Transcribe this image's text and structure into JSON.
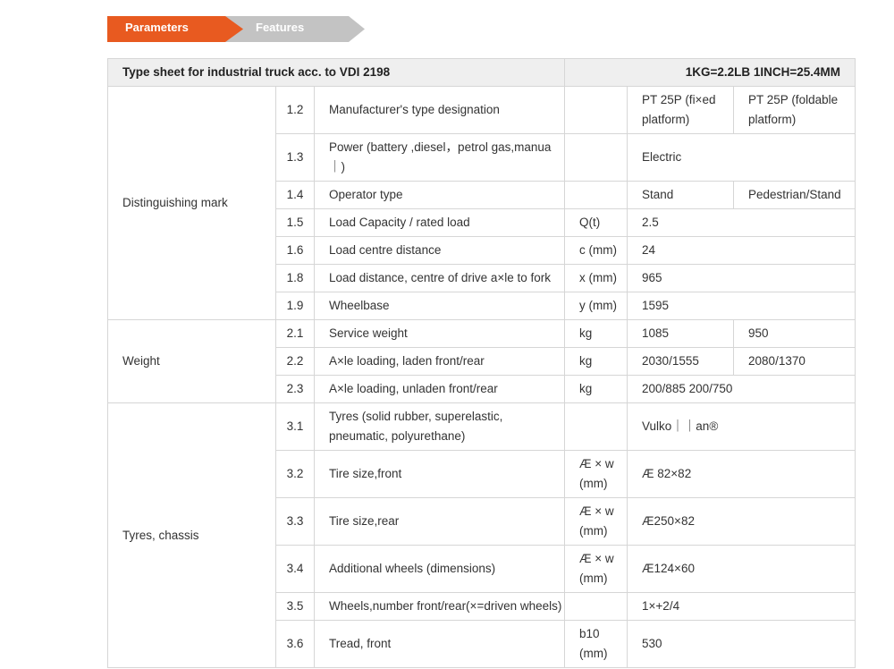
{
  "tabs": {
    "parameters": "Parameters",
    "features": "Features"
  },
  "header": {
    "title": "Type sheet for industrial truck acc. to VDI 2198",
    "units": "1KG=2.2LB 1INCH=25.4MM"
  },
  "groups": {
    "distinguishing": "Distinguishing mark",
    "weight": "Weight",
    "tyres": "Tyres, chassis"
  },
  "rows": [
    {
      "num": "1.2",
      "label": "Manufacturer's type designation",
      "unit": "",
      "v1": "PT 25P (fi×ed platform)",
      "v2": "PT 25P (foldable platform)"
    },
    {
      "num": "1.3",
      "label": "Power (battery ,diesel，petrol gas,manua｜)",
      "unit": "",
      "v1": "Electric",
      "v2": ""
    },
    {
      "num": "1.4",
      "label": "Operator type",
      "unit": "",
      "v1": "Stand",
      "v2": "Pedestrian/Stand"
    },
    {
      "num": "1.5",
      "label": "Load Capacity / rated load",
      "unit": "Q(t)",
      "v1": "2.5",
      "v2": ""
    },
    {
      "num": "1.6",
      "label": "Load centre distance",
      "unit": "c (mm)",
      "v1": "24",
      "v2": ""
    },
    {
      "num": "1.8",
      "label": "Load distance, centre of drive a×le to fork",
      "unit": "x (mm)",
      "v1": "965",
      "v2": ""
    },
    {
      "num": "1.9",
      "label": "Wheelbase",
      "unit": "y (mm)",
      "v1": "1595",
      "v2": ""
    },
    {
      "num": "2.1",
      "label": "Service weight",
      "unit": "kg",
      "v1": "1085",
      "v2": "950"
    },
    {
      "num": "2.2",
      "label": "A×le loading, laden front/rear",
      "unit": "kg",
      "v1": "2030/1555",
      "v2": "2080/1370"
    },
    {
      "num": "2.3",
      "label": "A×le loading, unladen front/rear",
      "unit": "kg",
      "v1": "200/885 200/750",
      "v2": ""
    },
    {
      "num": "3.1",
      "label": "Tyres (solid rubber, superelastic, pneumatic, polyurethane)",
      "unit": "",
      "v1": "Vulko｜｜an®",
      "v2": ""
    },
    {
      "num": "3.2",
      "label": "Tire size,front",
      "unit": "Æ × w (mm)",
      "v1": "Æ 82×82",
      "v2": ""
    },
    {
      "num": "3.3",
      "label": "Tire size,rear",
      "unit": "Æ × w (mm)",
      "v1": "Æ250×82",
      "v2": ""
    },
    {
      "num": "3.4",
      "label": "Additional wheels (dimensions)",
      "unit": "Æ × w (mm)",
      "v1": "Æ124×60",
      "v2": ""
    },
    {
      "num": "3.5",
      "label": "Wheels,number front/rear(×=driven wheels)",
      "unit": "",
      "v1": "1×+2/4",
      "v2": ""
    },
    {
      "num": "3.6",
      "label": "Tread, front",
      "unit": "b10 (mm)",
      "v1": "530",
      "v2": ""
    }
  ]
}
